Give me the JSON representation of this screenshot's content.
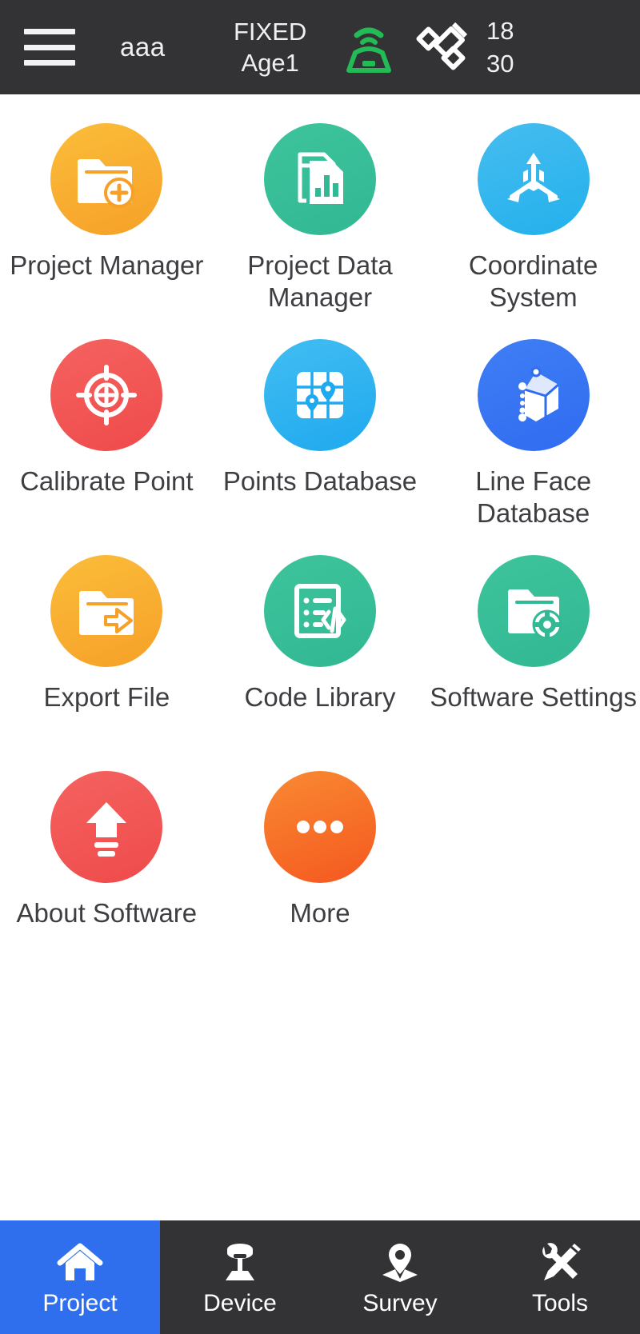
{
  "header": {
    "menu_icon": "hamburger-menu-icon",
    "project_name": "aaa",
    "fix_status": "FIXED",
    "age_status": "Age1",
    "receiver_icon": "gnss-receiver-icon",
    "satellite_icon": "satellite-icon",
    "satellites_used": "18",
    "satellites_total": "30",
    "bg_color": "#333335",
    "receiver_color": "#22bb55"
  },
  "grid": {
    "items": [
      {
        "label": "Project Manager",
        "icon": "folder-add-icon",
        "color_start": "#fbbd3a",
        "color_end": "#f6a028"
      },
      {
        "label": "Project Data Manager",
        "icon": "document-chart-icon",
        "color_start": "#3ec49b",
        "color_end": "#31b894"
      },
      {
        "label": "Coordinate System",
        "icon": "three-axis-icon",
        "color_start": "#46bdf0",
        "color_end": "#23b0ec"
      },
      {
        "label": "Calibrate Point",
        "icon": "crosshair-target-icon",
        "color_start": "#f4625f",
        "color_end": "#ef4b4b"
      },
      {
        "label": "Points Database",
        "icon": "grid-map-pins-icon",
        "color_start": "#42bdf2",
        "color_end": "#1fa9ef"
      },
      {
        "label": "Line Face Database",
        "icon": "cube-3d-icon",
        "color_start": "#3f7ef5",
        "color_end": "#2f6cf0"
      },
      {
        "label": "Export File",
        "icon": "folder-export-icon",
        "color_start": "#fbbd3a",
        "color_end": "#f6a028"
      },
      {
        "label": "Code Library",
        "icon": "code-list-icon",
        "color_start": "#3ec49b",
        "color_end": "#31b894"
      },
      {
        "label": "Software Settings",
        "icon": "folder-gear-icon",
        "color_start": "#3ec49b",
        "color_end": "#31b894"
      },
      {
        "label": "About Software",
        "icon": "upload-arrow-icon",
        "color_start": "#f4625f",
        "color_end": "#ef4b4b"
      },
      {
        "label": "More",
        "icon": "ellipsis-icon",
        "color_start": "#f98a32",
        "color_end": "#f4581f"
      }
    ]
  },
  "bottom_nav": {
    "active_color": "#2f6fee",
    "items": [
      {
        "label": "Project",
        "icon": "home-icon",
        "active": true
      },
      {
        "label": "Device",
        "icon": "gnss-tripod-icon",
        "active": false
      },
      {
        "label": "Survey",
        "icon": "map-pin-plane-icon",
        "active": false
      },
      {
        "label": "Tools",
        "icon": "wrench-screwdriver-icon",
        "active": false
      }
    ]
  }
}
